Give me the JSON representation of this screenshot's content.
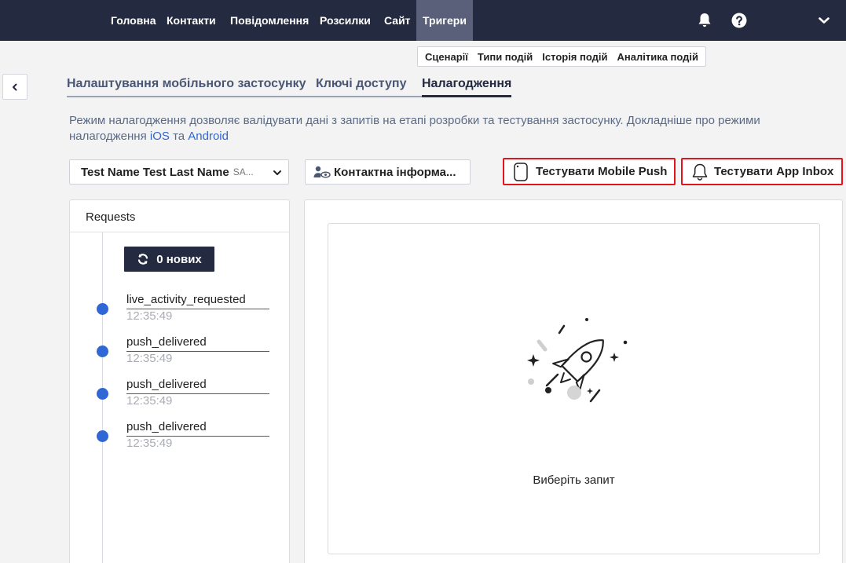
{
  "nav": {
    "items": [
      "Головна",
      "Контакти",
      "Повідомлення",
      "Розсилки",
      "Сайт",
      "Тригери"
    ],
    "active": "Тригери"
  },
  "subnav": [
    "Сценарії",
    "Типи подій",
    "Історія подій",
    "Аналітика подій"
  ],
  "tabs": [
    "Налаштування мобільного застосунку",
    "Ключі доступу",
    "Налагодження"
  ],
  "description": {
    "text": "Режим налагодження дозволяє валідувати дані з запитів на етапі розробки та тестування застосунку. Докладніше про режими налагодження",
    "link_ios": "iOS",
    "and": "та",
    "link_android": "Android"
  },
  "contact_select": {
    "main": "Test Name Test Last Name",
    "suffix": "SA..."
  },
  "buttons": {
    "contact_info": "Контактна інформа...",
    "test_push": "Тестувати Mobile Push",
    "test_inbox": "Тестувати App Inbox"
  },
  "requests": {
    "title": "Requests",
    "new_label": "0 нових",
    "items": [
      {
        "name": "live_activity_requested",
        "time": "12:35:49"
      },
      {
        "name": "push_delivered",
        "time": "12:35:49"
      },
      {
        "name": "push_delivered",
        "time": "12:35:49"
      },
      {
        "name": "push_delivered",
        "time": "12:35:49"
      }
    ]
  },
  "detail": {
    "empty_text": "Виберіть запит"
  },
  "colors": {
    "topbar": "#242a40",
    "highlight": "#e3141c",
    "link": "#3366cc",
    "dot": "#2f67d6"
  }
}
